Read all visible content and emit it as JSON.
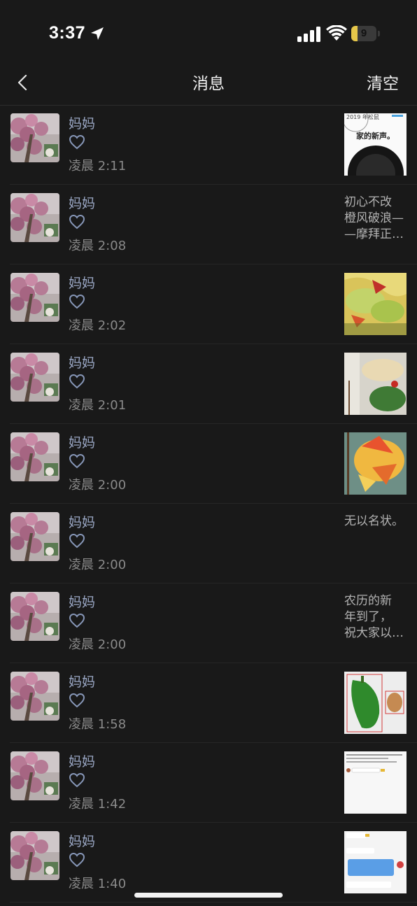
{
  "status_bar": {
    "time": "3:37",
    "battery": "9",
    "battery_level": 0.09
  },
  "nav": {
    "back_icon": "chevron-left-icon",
    "title": "消息",
    "clear_label": "清空"
  },
  "colors": {
    "background": "#191919",
    "sender_name": "#9aa7c4",
    "time_text": "#8a8a8a",
    "divider": "#262626"
  },
  "messages": [
    {
      "sender": "妈妈",
      "time": "凌晨 2:11",
      "preview": {
        "kind": "image",
        "icon": "article-screenshot-icon",
        "text": "家的新声。",
        "text2": "2019 年松鼠"
      }
    },
    {
      "sender": "妈妈",
      "time": "凌晨 2:08",
      "preview": {
        "kind": "text",
        "text": "初心不改\n橙风破浪—\n—摩拜正…"
      }
    },
    {
      "sender": "妈妈",
      "time": "凌晨 2:02",
      "preview": {
        "kind": "image",
        "icon": "food-photo-icon"
      }
    },
    {
      "sender": "妈妈",
      "time": "凌晨 2:01",
      "preview": {
        "kind": "image",
        "icon": "food-photo-icon"
      }
    },
    {
      "sender": "妈妈",
      "time": "凌晨 2:00",
      "preview": {
        "kind": "image",
        "icon": "food-photo-icon"
      }
    },
    {
      "sender": "妈妈",
      "time": "凌晨 2:00",
      "preview": {
        "kind": "text",
        "text": "无以名状。"
      }
    },
    {
      "sender": "妈妈",
      "time": "凌晨 2:00",
      "preview": {
        "kind": "text",
        "text": "农历的新\n年到了，\n祝大家以…"
      }
    },
    {
      "sender": "妈妈",
      "time": "凌晨 1:58",
      "preview": {
        "kind": "image",
        "icon": "vegetable-photo-icon"
      }
    },
    {
      "sender": "妈妈",
      "time": "凌晨 1:42",
      "preview": {
        "kind": "image",
        "icon": "chat-screenshot-icon"
      }
    },
    {
      "sender": "妈妈",
      "time": "凌晨 1:40",
      "preview": {
        "kind": "image",
        "icon": "chat-screenshot-icon"
      }
    }
  ]
}
